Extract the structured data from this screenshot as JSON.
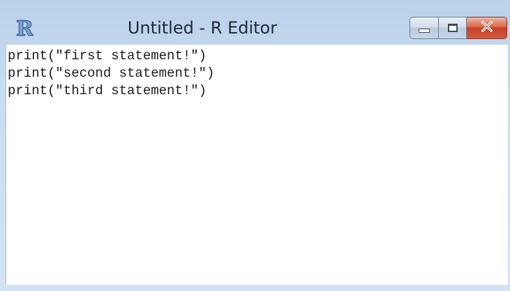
{
  "window": {
    "title": "Untitled - R Editor",
    "icon": "r-logo-icon"
  },
  "controls": {
    "minimize": "minimize-icon",
    "maximize": "maximize-icon",
    "close": "close-icon"
  },
  "editor": {
    "lines": [
      "print(\"first statement!\")",
      "print(\"second statement!\")",
      "print(\"third statement!\")"
    ]
  },
  "colors": {
    "frame": "#c9dcf0",
    "close_button": "#c7402a",
    "text": "#1c1c1c"
  }
}
